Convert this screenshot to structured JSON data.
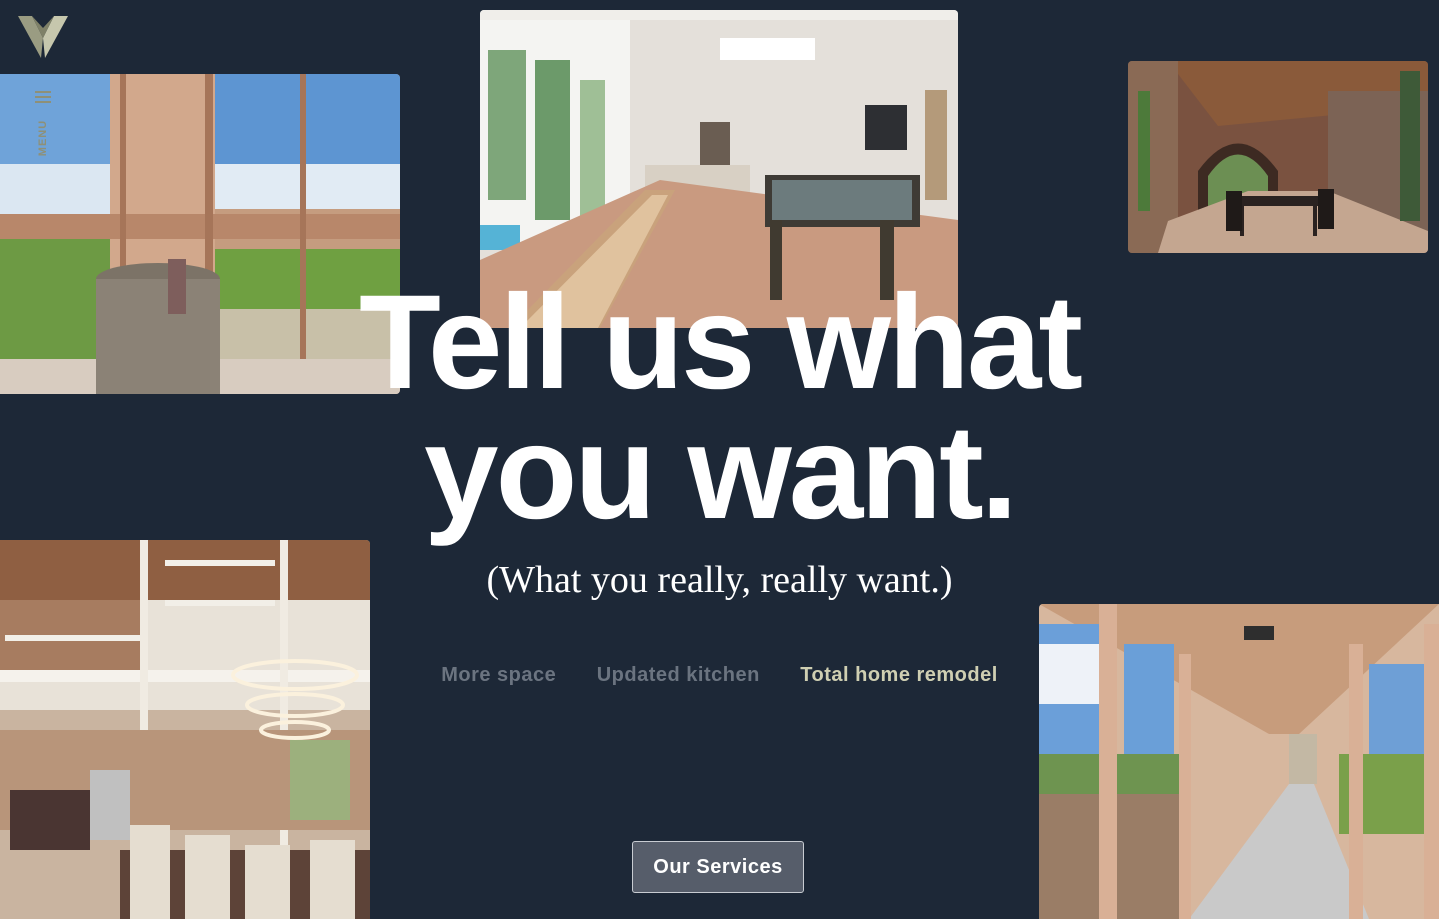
{
  "brand": {
    "logo_icon": "v-logo-icon",
    "colors": {
      "background": "#1d2837",
      "accent": "#cfcfb2",
      "olive": "#8e9078",
      "muted": "#6b7480"
    }
  },
  "menu": {
    "label": "MENU",
    "icon": "hamburger-icon"
  },
  "hero": {
    "headline_line1": "Tell us what",
    "headline_line2": "you want.",
    "subheadline": "(What you really, really want.)"
  },
  "tags": [
    {
      "label": "More space",
      "active": false
    },
    {
      "label": "Updated kitchen",
      "active": false
    },
    {
      "label": "Total home remodel",
      "active": true
    }
  ],
  "cta": {
    "label": "Our Services"
  }
}
